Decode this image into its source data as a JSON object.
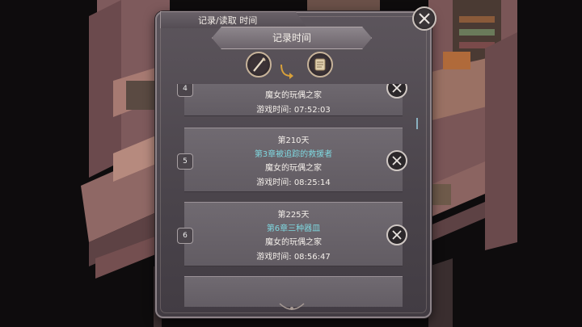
{
  "window": {
    "tab_title": "记录/读取 时间",
    "header": "记录时间"
  },
  "icons": {
    "close": "close-icon",
    "quill": "quill-icon",
    "scroll": "scroll-icon",
    "arrow": "curved-arrow-icon",
    "delete": "delete-icon"
  },
  "slots": [
    {
      "number": "4",
      "day": "",
      "chapter": "",
      "location": "魔女的玩偶之家",
      "playtime": "游戏时间:  07:52:03"
    },
    {
      "number": "5",
      "day": "第210天",
      "chapter": "第3章被追踪的救援者",
      "location": "魔女的玩偶之家",
      "playtime": "游戏时间:  08:25:14"
    },
    {
      "number": "6",
      "day": "第225天",
      "chapter": "第6章三种器皿",
      "location": "魔女的玩偶之家",
      "playtime": "游戏时间:  08:56:47"
    }
  ],
  "colors": {
    "chapter_text": "#7fd8e0",
    "panel": "#4e484f"
  }
}
